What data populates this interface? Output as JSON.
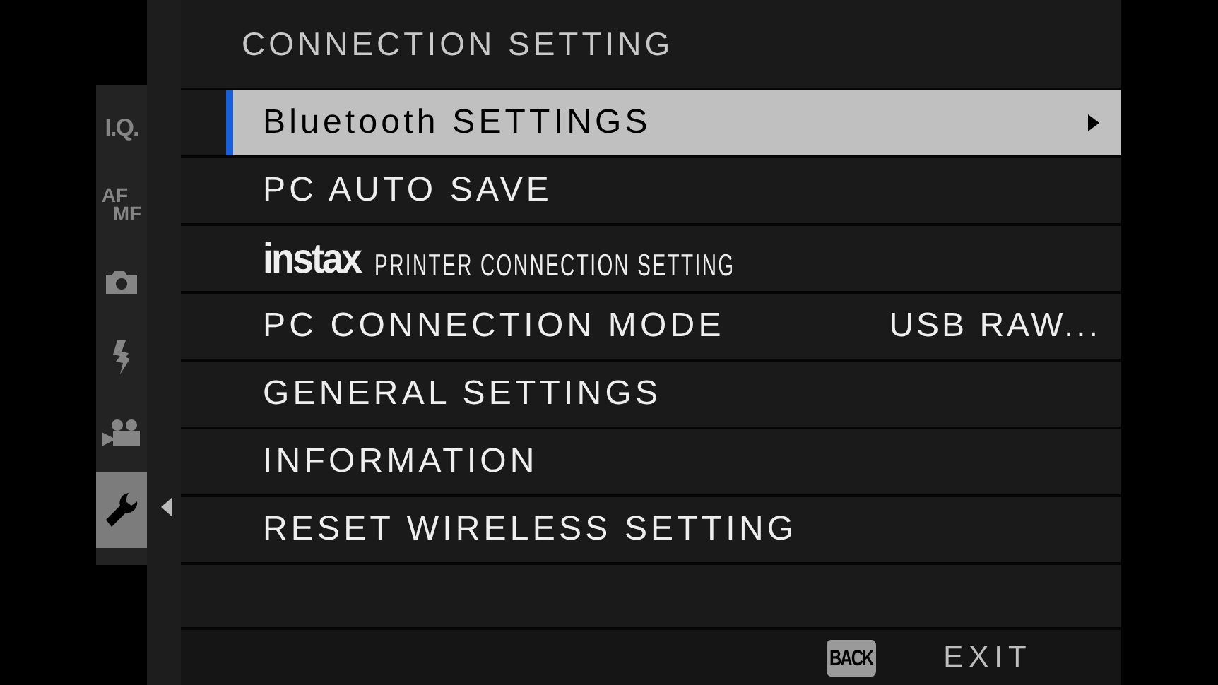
{
  "sidebar": {
    "tabs": [
      {
        "kind": "text",
        "label": "I.Q.",
        "selected": false
      },
      {
        "kind": "stacked",
        "label": "AF",
        "sublabel": "MF",
        "selected": false
      },
      {
        "kind": "camera",
        "selected": false
      },
      {
        "kind": "flash",
        "selected": false
      },
      {
        "kind": "movie",
        "selected": false
      },
      {
        "kind": "wrench",
        "selected": true
      }
    ]
  },
  "menu": {
    "title": "CONNECTION SETTING",
    "rows": [
      {
        "kind": "plain",
        "label": "Bluetooth SETTINGS",
        "selected": true
      },
      {
        "kind": "plain",
        "label": "PC AUTO SAVE",
        "selected": false
      },
      {
        "kind": "instax",
        "brand": "instax",
        "label": "PRINTER CONNECTION SETTING",
        "selected": false
      },
      {
        "kind": "plain",
        "label": "PC CONNECTION MODE",
        "value": "USB RAW...",
        "selected": false
      },
      {
        "kind": "plain",
        "label": "GENERAL SETTINGS",
        "selected": false
      },
      {
        "kind": "plain",
        "label": "INFORMATION",
        "selected": false
      },
      {
        "kind": "plain",
        "label": "RESET WIRELESS SETTING",
        "selected": false
      }
    ]
  },
  "footer": {
    "back_key": "BACK",
    "action": "EXIT"
  }
}
